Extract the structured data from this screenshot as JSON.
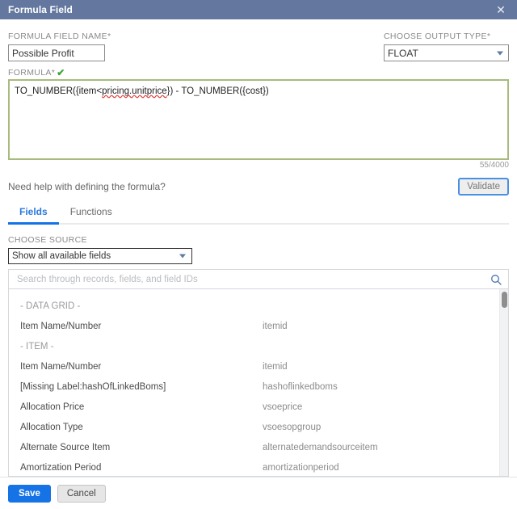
{
  "titlebar": {
    "title": "Formula Field",
    "close_label": "✕",
    "background": "#64789f"
  },
  "form": {
    "name_label": "FORMULA FIELD NAME*",
    "name_value": "Possible Profit",
    "output_type_label": "CHOOSE OUTPUT TYPE*",
    "output_type_value": "FLOAT",
    "formula_label": "FORMULA*",
    "formula_valid_icon": "✔",
    "formula_prefix": "TO_NUMBER({item<",
    "formula_spellchecked": "pricing.unitprice",
    "formula_suffix": "}) - TO_NUMBER({cost})",
    "char_count": "55/4000"
  },
  "help": {
    "text": "Need help with defining the formula?",
    "validate_label": "Validate"
  },
  "tabs": [
    {
      "label": "Fields",
      "active": true
    },
    {
      "label": "Functions",
      "active": false
    }
  ],
  "source": {
    "label": "CHOOSE SOURCE",
    "value": "Show all available fields"
  },
  "search": {
    "placeholder": "Search through records, fields, and field IDs",
    "value": "",
    "icon": "search-icon"
  },
  "field_list": [
    {
      "type": "group",
      "name": "- DATA GRID -",
      "id": ""
    },
    {
      "type": "item",
      "name": "Item Name/Number",
      "id": "itemid"
    },
    {
      "type": "group",
      "name": "- ITEM -",
      "id": ""
    },
    {
      "type": "item",
      "name": "Item Name/Number",
      "id": "itemid"
    },
    {
      "type": "item",
      "name": "[Missing Label:hashOfLinkedBoms]",
      "id": "hashoflinkedboms"
    },
    {
      "type": "item",
      "name": "Allocation Price",
      "id": "vsoeprice"
    },
    {
      "type": "item",
      "name": "Allocation Type",
      "id": "vsoesopgroup"
    },
    {
      "type": "item",
      "name": "Alternate Source Item",
      "id": "alternatedemandsourceitem"
    },
    {
      "type": "item",
      "name": "Amortization Period",
      "id": "amortizationperiod"
    }
  ],
  "footer": {
    "save_label": "Save",
    "cancel_label": "Cancel"
  },
  "colors": {
    "title_bar": "#64789f",
    "accent_blue": "#1673e6",
    "formula_border": "#a8bb7e",
    "valid_green": "#3aa53a"
  }
}
